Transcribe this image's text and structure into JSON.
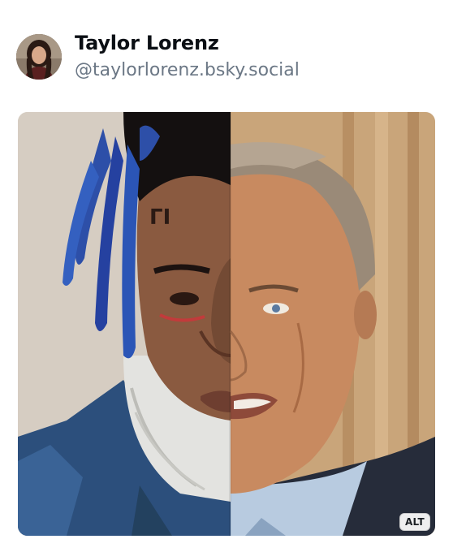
{
  "post": {
    "author": {
      "display_name": "Taylor Lorenz",
      "handle": "@taylorlorenz.bsky.social",
      "avatar_icon": "avatar-photo"
    },
    "media": {
      "alt_badge": "ALT",
      "image_icon": "split-face-photo"
    }
  }
}
